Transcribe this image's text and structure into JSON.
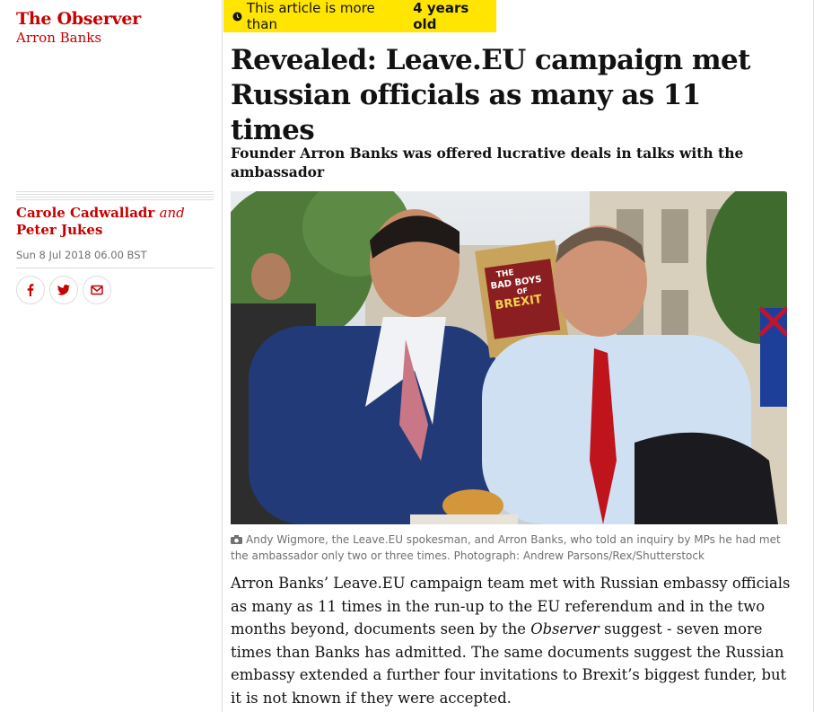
{
  "masthead": {
    "section": "The Observer",
    "series": "Arron Banks"
  },
  "byline": {
    "author1": "Carole Cadwalladr",
    "joiner": "and",
    "author2": "Peter Jukes",
    "date": "Sun 8 Jul 2018 06.00 BST"
  },
  "share": {
    "facebook_icon": "facebook-icon",
    "twitter_icon": "twitter-icon",
    "email_icon": "email-icon"
  },
  "age_badge": {
    "prefix": "This article is more than",
    "age": "4 years old",
    "color": "#ffe500"
  },
  "headline": "Revealed: Leave.EU campaign met Russian officials as many as 11 times",
  "standfirst": "Founder Arron Banks was offered lucrative deals in talks with the ambassador",
  "photo": {
    "book_line1": "THE",
    "book_line2": "BAD BOYS",
    "book_line3": "OF",
    "book_line4": "BREXIT"
  },
  "caption": "Andy Wigmore, the Leave.EU spokesman, and Arron Banks, who told an inquiry by MPs he had met the ambassador only two or three times. Photograph: Andrew Parsons/Rex/Shutterstock",
  "body": {
    "part1": "Arron Banks’ Leave.EU campaign team met with Russian embassy officials as many as 11 times in the run-up to the EU referendum and in the two months beyond, documents seen by the ",
    "publication": "Observer",
    "part2": " suggest - seven more times than Banks has admitted. The same documents suggest the Russian embassy extended a further four invitations to Brexit’s biggest funder, but it is not known if they were accepted."
  },
  "colors": {
    "brand_red": "#c70000",
    "badge_yellow": "#ffe500",
    "caption_grey": "#707070"
  }
}
